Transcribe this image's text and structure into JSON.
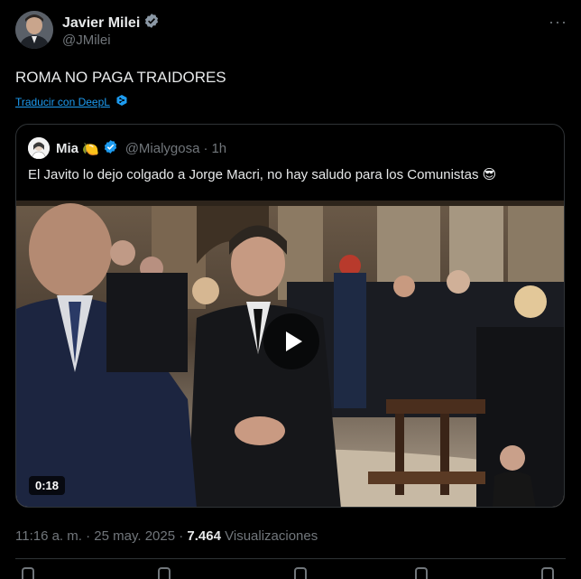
{
  "author": {
    "name": "Javier Milei",
    "handle": "@JMilei",
    "verified_icon": "verified-badge-icon",
    "more_icon": "more-horizontal-icon"
  },
  "tweet": {
    "text": "ROMA NO PAGA TRAIDORES",
    "translate_label": "Traducir con DeepL"
  },
  "quote": {
    "name": "Mia",
    "name_emoji": "🍋",
    "handle": "@Mialygosa",
    "separator": "·",
    "time": "1h",
    "text": "El Javito lo dejo colgado a Jorge Macri, no hay saludo para los Comunistas 😎",
    "video": {
      "duration": "0:18",
      "play_icon": "play-icon"
    }
  },
  "meta": {
    "time": "11:16 a. m.",
    "separator": "·",
    "date": "25 may. 2025",
    "separator2": "·",
    "views_count": "7.464",
    "views_label": "Visualizaciones"
  },
  "colors": {
    "background": "#000000",
    "accent": "#1d9bf0",
    "secondary_text": "#71767b",
    "border": "#2f3336"
  }
}
